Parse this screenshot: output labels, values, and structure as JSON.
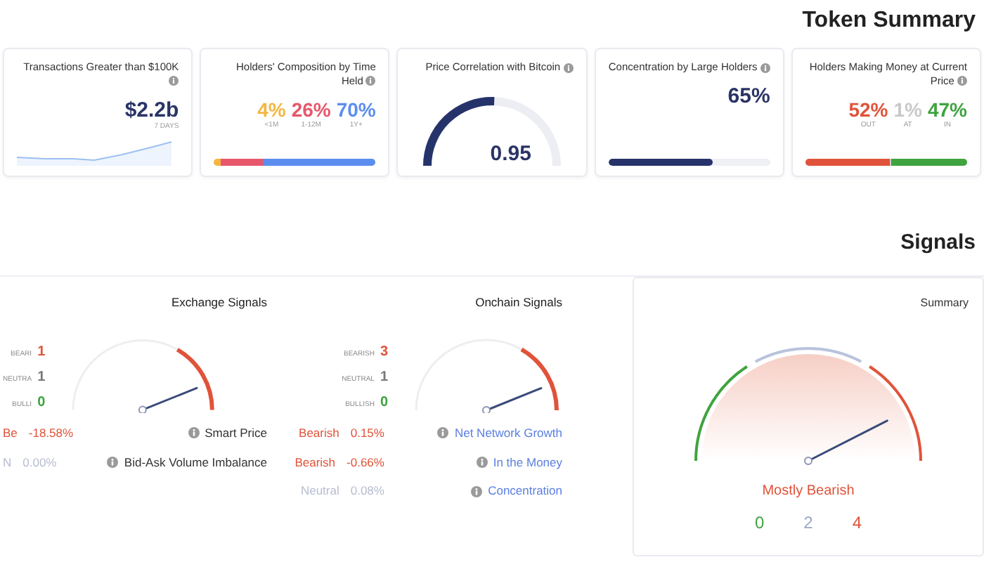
{
  "title": "Token Summary",
  "cards": [
    {
      "kind": "sparkline",
      "title": "Transactions Greater than $100K",
      "value": "$2.2b",
      "caption": "7 DAYS"
    },
    {
      "kind": "split",
      "title": "Holders' Composition by Time Held",
      "parts": [
        {
          "value": "4%",
          "label": "<1M",
          "color": "#f5b640",
          "level": 0.04
        },
        {
          "value": "26%",
          "label": "1-12M",
          "color": "#e8566b",
          "level": 0.26
        },
        {
          "value": "70%",
          "label": "1Y+",
          "color": "#5b8def",
          "level": 0.7
        }
      ]
    },
    {
      "kind": "gauge",
      "title": "Price Correlation with Bitcoin",
      "value": "0.95"
    },
    {
      "kind": "bar",
      "title": "Concentration by Large Holders",
      "value": "65%",
      "level": 0.65
    },
    {
      "kind": "split",
      "title": "Holders Making Money at Current Price",
      "parts": [
        {
          "value": "52%",
          "label": "OUT",
          "color": "#e0533a",
          "level": 0.52
        },
        {
          "value": "1%",
          "label": "AT",
          "color": "#c8c8c8",
          "level": 0.01
        },
        {
          "value": "47%",
          "label": "IN",
          "color": "#3fa33f",
          "level": 0.47
        }
      ]
    }
  ],
  "signals": {
    "title": "Signals",
    "groups": [
      {
        "title": "Exchange Signals",
        "counts": [
          {
            "value": "1",
            "label": "BEARI",
            "color": "#e0533a"
          },
          {
            "value": "1",
            "label": "NEUTRA",
            "color": "#777777"
          },
          {
            "value": "0",
            "label": "BULLI",
            "color": "#3fa33f"
          }
        ],
        "rows": [
          {
            "name": "Smart Price",
            "value": "-18.58%",
            "verdict": "Be",
            "color": "#e0533a"
          },
          {
            "name": "Bid-Ask Volume Imbalance",
            "value": "0.00%",
            "verdict": "N",
            "color": "#b7bdd0"
          }
        ]
      },
      {
        "title": "Onchain Signals",
        "counts": [
          {
            "value": "3",
            "label": "BEARISH",
            "color": "#e0533a"
          },
          {
            "value": "1",
            "label": "NEUTRAL",
            "color": "#777777"
          },
          {
            "value": "0",
            "label": "BULLISH",
            "color": "#3fa33f"
          }
        ],
        "rows": [
          {
            "name": "Net Network Growth",
            "value": "0.15%",
            "verdict": "Bearish",
            "color": "#e0533a"
          },
          {
            "name": "In the Money",
            "value": "-0.66%",
            "verdict": "Bearish",
            "color": "#e0533a"
          },
          {
            "name": "Concentration",
            "value": "0.08%",
            "verdict": "Neutral",
            "color": "#b7bdd0"
          }
        ]
      }
    ],
    "summary": {
      "title": "Summary",
      "verdict": "Mostly Bearish",
      "counts": [
        {
          "value": "0",
          "color": "#3fa33f"
        },
        {
          "value": "2",
          "color": "#9aa6c6"
        },
        {
          "value": "4",
          "color": "#e0533a"
        }
      ]
    }
  }
}
